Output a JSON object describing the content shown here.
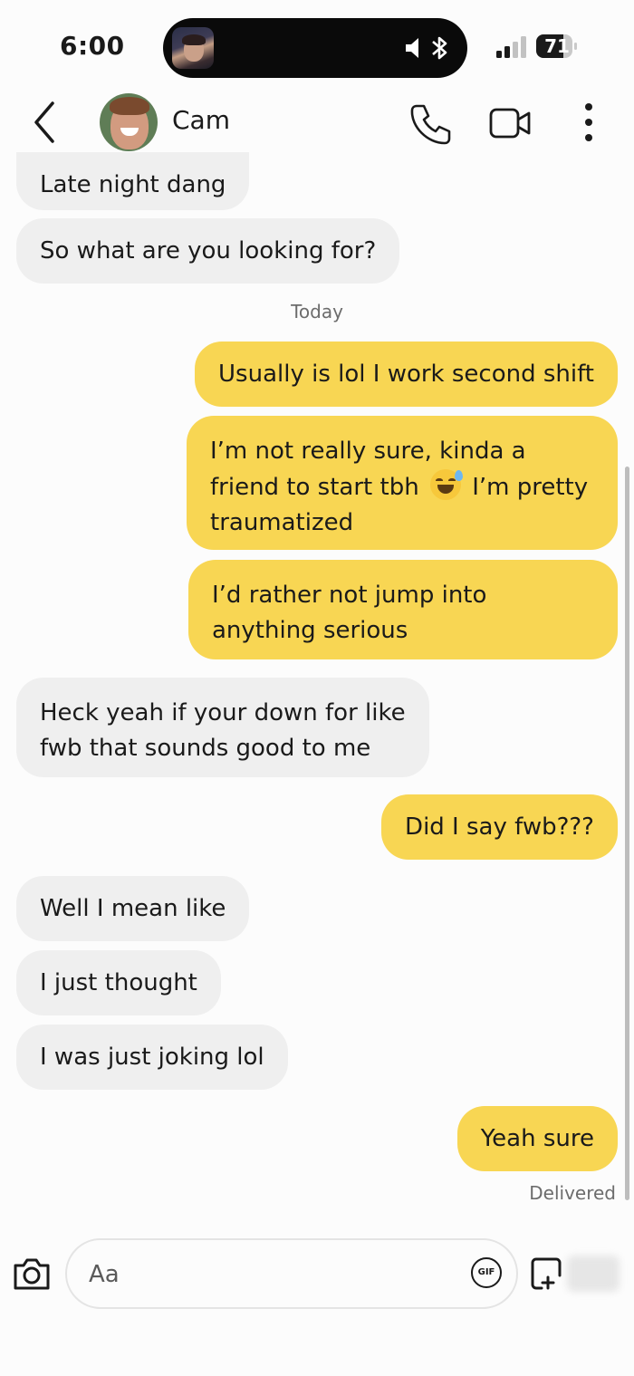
{
  "status_bar": {
    "time": "6:00",
    "battery": "71",
    "icons": [
      "now-playing-art",
      "speaker-icon",
      "bluetooth-icon",
      "signal-icon",
      "battery-icon"
    ]
  },
  "header": {
    "contact_name": "Cam",
    "icons": [
      "back-icon",
      "avatar",
      "phone-icon",
      "video-icon",
      "more-icon"
    ]
  },
  "colors": {
    "outgoing_bubble": "#f8d653",
    "incoming_bubble": "#efefef",
    "background": "#fcfcfc",
    "meta_text": "#6c6c6c"
  },
  "conversation": {
    "date_separator": "Today",
    "messages": [
      {
        "from": "them",
        "text": "Late night dang"
      },
      {
        "from": "them",
        "text": "So what are you looking for?"
      },
      {
        "from": "me",
        "text": "Usually is lol I work second shift"
      },
      {
        "from": "me",
        "text_before": "I’m not really sure, kinda a friend to start tbh",
        "emoji": "sweat-smile-emoji",
        "text_after": "I’m pretty traumatized"
      },
      {
        "from": "me",
        "text": "I’d rather not jump into anything serious"
      },
      {
        "from": "them",
        "text": "Heck yeah if your down for like fwb that sounds good to me"
      },
      {
        "from": "me",
        "text": "Did I say fwb???"
      },
      {
        "from": "them",
        "text": "Well I mean like"
      },
      {
        "from": "them",
        "text": "I just thought"
      },
      {
        "from": "them",
        "text": "I was just joking lol"
      },
      {
        "from": "me",
        "text": "Yeah sure"
      }
    ],
    "delivered_label": "Delivered"
  },
  "composer": {
    "placeholder": "Aa",
    "gif_label": "GIF",
    "icons": [
      "camera-icon",
      "gif-icon",
      "sticker-icon"
    ]
  }
}
